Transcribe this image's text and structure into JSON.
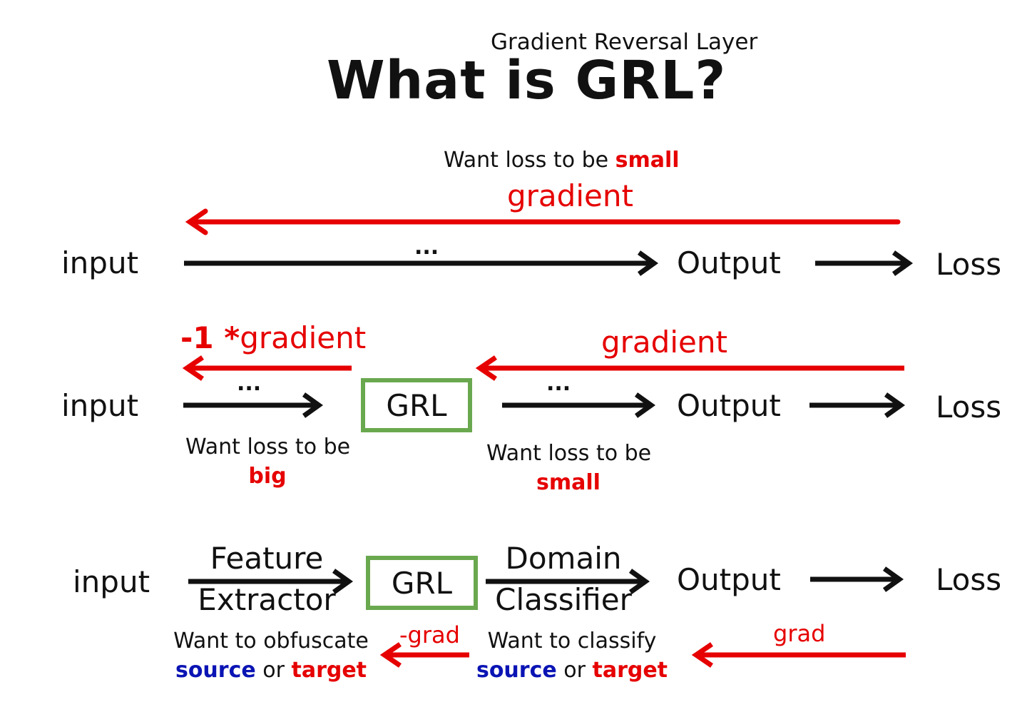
{
  "header": {
    "subtitle": "Gradient Reversal Layer",
    "title": "What is GRL?"
  },
  "row1": {
    "want_prefix": "Want loss to be ",
    "want_word": "small",
    "gradient": "gradient",
    "input": "input",
    "dots": "...",
    "output": "Output",
    "loss": "Loss"
  },
  "row2": {
    "neg_prefix": "-1 *",
    "neg_gradient": "gradient",
    "gradient": "gradient",
    "input": "input",
    "dots_left": "...",
    "grl": "GRL",
    "dots_right": "...",
    "output": "Output",
    "loss": "Loss",
    "left_want": "Want loss to be",
    "left_word": "big",
    "right_want": "Want loss to be",
    "right_word": "small"
  },
  "row3": {
    "input": "input",
    "feature_1": "Feature",
    "feature_2": "Extractor",
    "grl": "GRL",
    "domain_1": "Domain",
    "domain_2": "Classifier",
    "output": "Output",
    "loss": "Loss",
    "neg_grad": "-grad",
    "grad": "grad",
    "left_want": "Want to obfuscate",
    "right_want": "Want to classify",
    "source": "source",
    "or": " or ",
    "target": "target"
  },
  "colors": {
    "red": "#e60000",
    "blue": "#0a14b4",
    "green": "#6aa84f",
    "black": "#111111"
  }
}
